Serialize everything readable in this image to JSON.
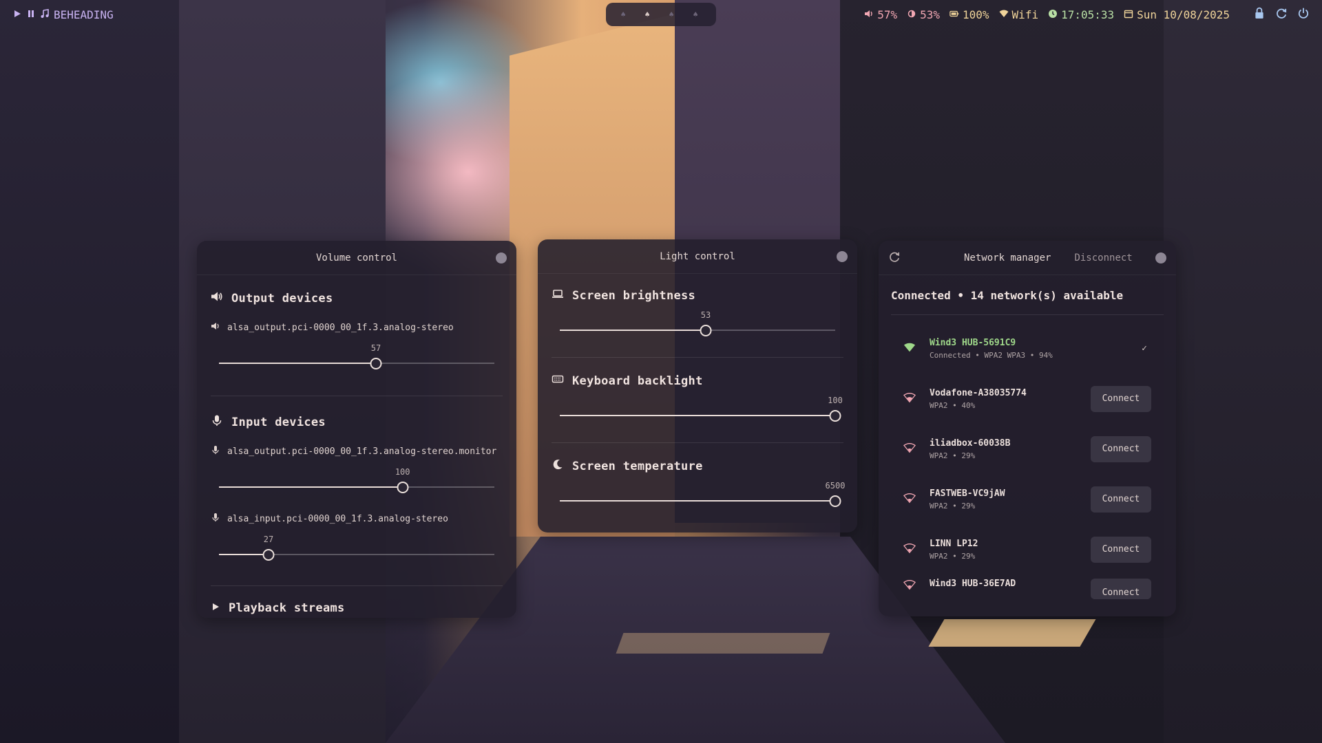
{
  "topbar": {
    "now_playing": "BEHEADING",
    "volume": "57%",
    "brightness": "53%",
    "battery": "100%",
    "network": "Wifi",
    "clock": "17:05:33",
    "date": "Sun 10/08/2025",
    "icons": [
      "play-icon",
      "pause-icon",
      "music-note-icon",
      "volume-icon",
      "brightness-icon",
      "battery-icon",
      "wifi-icon",
      "clock-icon",
      "calendar-icon",
      "lock-icon",
      "refresh-icon",
      "power-icon"
    ],
    "colors": {
      "accent_pink": "#f2a7b3",
      "accent_yellow": "#f0d49a",
      "accent_green": "#b9e0a5",
      "accent_blue": "#a9c8f0",
      "accent_lavender": "#cdb6f5"
    }
  },
  "volume_panel": {
    "title": "Volume control",
    "output_section": "Output devices",
    "output_devices": [
      {
        "name": "alsa_output.pci-0000_00_1f.3.analog-stereo",
        "value": 57,
        "value_label": "57",
        "max": 100
      }
    ],
    "input_section": "Input devices",
    "input_devices": [
      {
        "name": "alsa_output.pci-0000_00_1f.3.analog-stereo.monitor",
        "value": 100,
        "value_label": "100",
        "max": 150
      },
      {
        "name": "alsa_input.pci-0000_00_1f.3.analog-stereo",
        "value": 27,
        "value_label": "27",
        "max": 150
      }
    ],
    "playback_section": "Playback streams"
  },
  "light_panel": {
    "title": "Light control",
    "brightness_title": "Screen brightness",
    "brightness_value": 53,
    "brightness_label": "53",
    "brightness_max": 100,
    "keyboard_title": "Keyboard backlight",
    "keyboard_value": 100,
    "keyboard_label": "100",
    "keyboard_max": 100,
    "temperature_title": "Screen temperature",
    "temperature_value": 6500,
    "temperature_label": "6500",
    "temperature_max": 6500
  },
  "network_panel": {
    "title": "Network manager",
    "disconnect_label": "Disconnect",
    "status": "Connected • 14 network(s) available",
    "connected_check": "✓",
    "networks": [
      {
        "ssid": "Wind3 HUB-5691C9",
        "detail": "Connected • WPA2 WPA3 • 94%",
        "connected": true
      },
      {
        "ssid": "Vodafone-A38035774",
        "detail": "WPA2 • 40%",
        "button": "Connect"
      },
      {
        "ssid": "iliadbox-60038B",
        "detail": "WPA2 • 29%",
        "button": "Connect"
      },
      {
        "ssid": "FASTWEB-VC9jAW",
        "detail": "WPA2 • 29%",
        "button": "Connect"
      },
      {
        "ssid": "LINN LP12",
        "detail": "WPA2 • 29%",
        "button": "Connect"
      },
      {
        "ssid": "Wind3 HUB-36E7AD",
        "detail": "",
        "button": "Connect"
      }
    ],
    "colors": {
      "connected": "#9fd88a",
      "signal": "#f2a7b3"
    }
  }
}
